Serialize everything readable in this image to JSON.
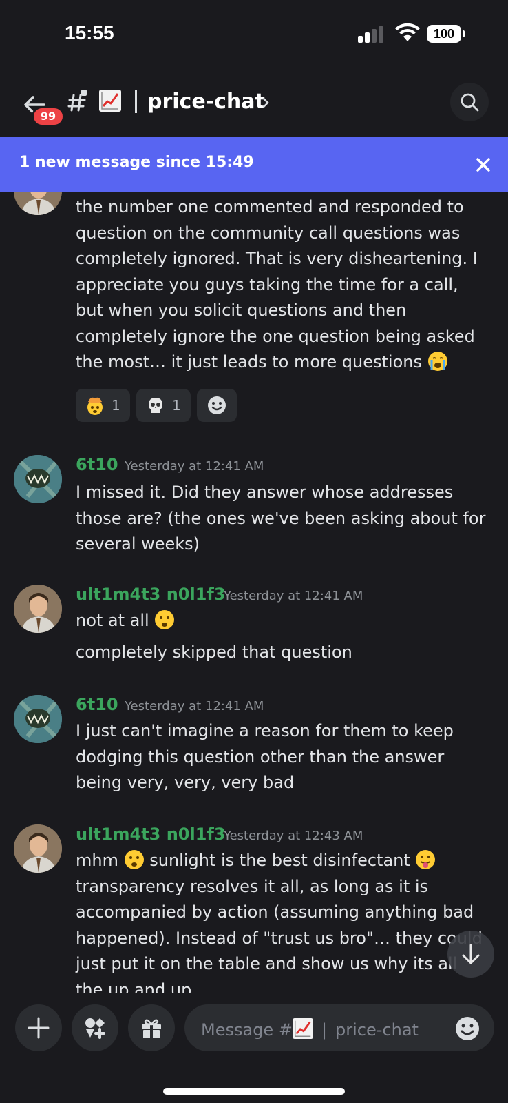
{
  "status_bar": {
    "time": "15:55",
    "battery": "100"
  },
  "header": {
    "unread_badge": "99",
    "channel_emoji": "chart-increasing-icon",
    "channel_name": "price-chat",
    "chevron": "›"
  },
  "banner": {
    "text": "1 new message since 15:49"
  },
  "messages": [
    {
      "text": "the number one commented and responded to question on the community call questions was completely ignored. That is very disheartening. I appreciate you guys taking the time for a call, but when you solicit questions and then completely ignore the one question being asked the most… it just leads to more questions",
      "reactions": [
        {
          "emoji": "exploding-head-icon",
          "count": "1"
        },
        {
          "emoji": "skull-icon",
          "count": "1"
        },
        {
          "emoji": "add-reaction-icon",
          "count": ""
        }
      ]
    },
    {
      "username": "6t10",
      "timestamp": "Yesterday at 12:41 AM",
      "lines": [
        "I missed it. Did they answer whose addresses those are? (the ones we've been asking about for several weeks)"
      ]
    },
    {
      "username": "ult1m4t3 n0l1f3",
      "timestamp": "Yesterday at 12:41 AM",
      "lines": [
        "not at all",
        "completely skipped that question"
      ]
    },
    {
      "username": "6t10",
      "timestamp": "Yesterday at 12:41 AM",
      "lines": [
        "I just can't imagine a reason for them to keep dodging this question other than the answer being very, very, very bad"
      ]
    },
    {
      "username": "ult1m4t3 n0l1f3",
      "timestamp": "Yesterday at 12:43 AM",
      "lines": [
        "mhm",
        "sunlight is the best disinfectant",
        "transparency resolves it all, as long as it is accompanied by action (assuming anything bad happened). Instead of \"trust us bro\"… they could just put it on the table and show us why its all the up and up"
      ]
    }
  ],
  "composer": {
    "placeholder_prefix": "Message #",
    "placeholder_channel": "price-chat"
  },
  "colors": {
    "banner": "#5865f2",
    "username": "#3ba55d",
    "badge": "#ed4245"
  }
}
